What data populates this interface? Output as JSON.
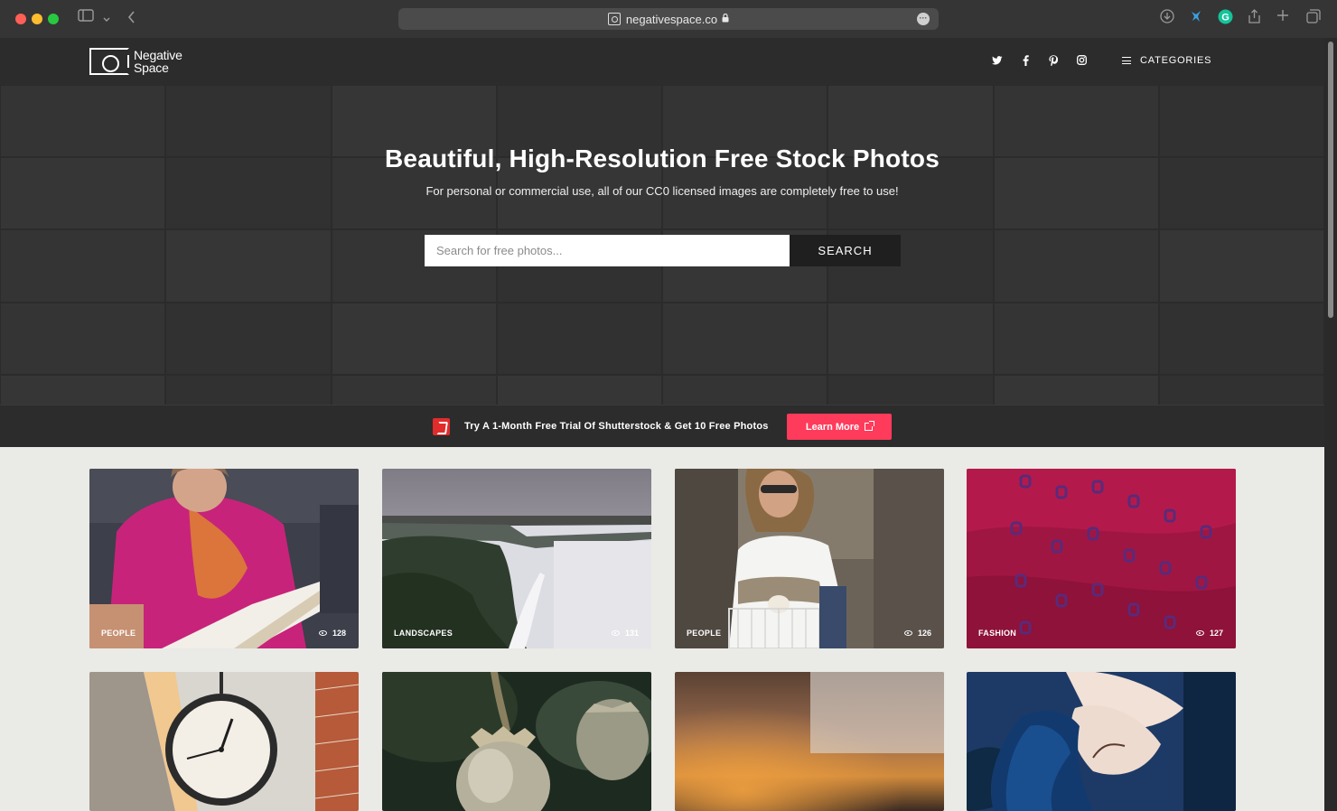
{
  "browser": {
    "url": "negativespace.co"
  },
  "header": {
    "logo_line1": "Negative",
    "logo_line2": "Space",
    "categories_label": "CATEGORIES"
  },
  "hero": {
    "title": "Beautiful, High-Resolution Free Stock Photos",
    "subtitle": "For personal or commercial use, all of our CC0 licensed images are completely free to use!",
    "search_placeholder": "Search for free photos...",
    "search_button": "SEARCH"
  },
  "promo": {
    "text": "Try A 1-Month Free Trial Of Shutterstock & Get 10 Free Photos",
    "button": "Learn More"
  },
  "gallery": {
    "cards": [
      {
        "category": "PEOPLE",
        "views": "128"
      },
      {
        "category": "LANDSCAPES",
        "views": "131"
      },
      {
        "category": "PEOPLE",
        "views": "126"
      },
      {
        "category": "FASHION",
        "views": "127"
      }
    ]
  },
  "colors": {
    "accent": "#ff3b5b",
    "hero_bg": "#2e2e2e",
    "gallery_bg": "#eaeae6"
  }
}
